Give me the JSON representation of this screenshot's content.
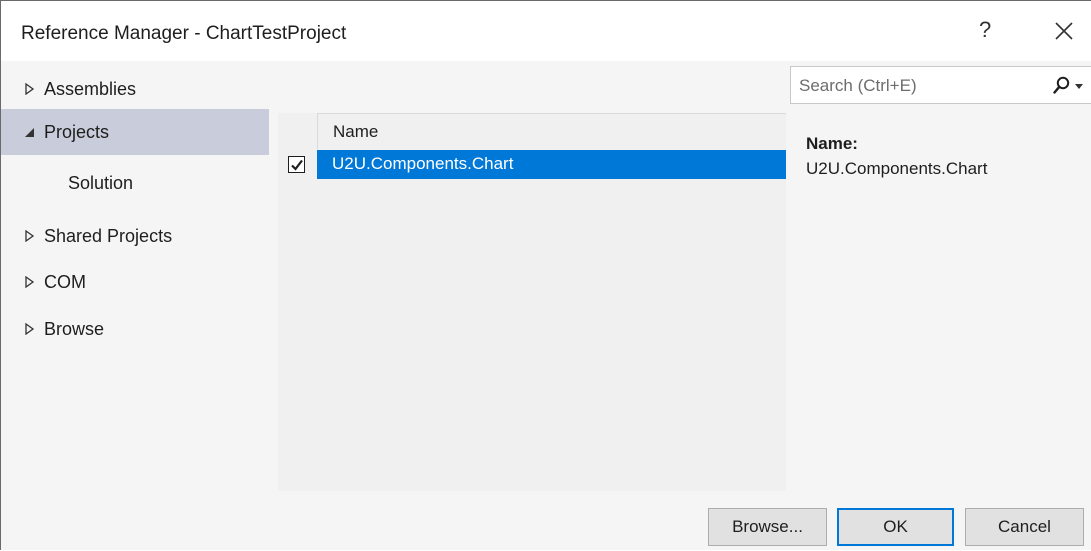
{
  "window": {
    "title": "Reference Manager - ChartTestProject",
    "help_label": "?"
  },
  "nav": {
    "items": [
      {
        "label": "Assemblies",
        "expanded": false,
        "selected": false
      },
      {
        "label": "Projects",
        "expanded": true,
        "selected": true
      },
      {
        "label": "Solution",
        "sub": true
      },
      {
        "label": "Shared Projects",
        "expanded": false
      },
      {
        "label": "COM",
        "expanded": false
      },
      {
        "label": "Browse",
        "expanded": false
      }
    ]
  },
  "search": {
    "placeholder": "Search (Ctrl+E)",
    "value": ""
  },
  "list": {
    "column_name": "Name",
    "rows": [
      {
        "name": "U2U.Components.Chart",
        "checked": true,
        "selected": true
      }
    ]
  },
  "details": {
    "label": "Name:",
    "value": "U2U.Components.Chart"
  },
  "buttons": {
    "browse": "Browse...",
    "ok": "OK",
    "cancel": "Cancel"
  },
  "colors": {
    "selection": "#0078d7",
    "nav_selected": "#c9ccda"
  },
  "icons": {
    "help": "help-icon",
    "close": "close-icon",
    "search": "search-icon",
    "dropdown": "chevron-down-icon",
    "collapsed": "triangle-right-icon",
    "expanded": "triangle-down-icon",
    "check": "checkmark-icon"
  }
}
